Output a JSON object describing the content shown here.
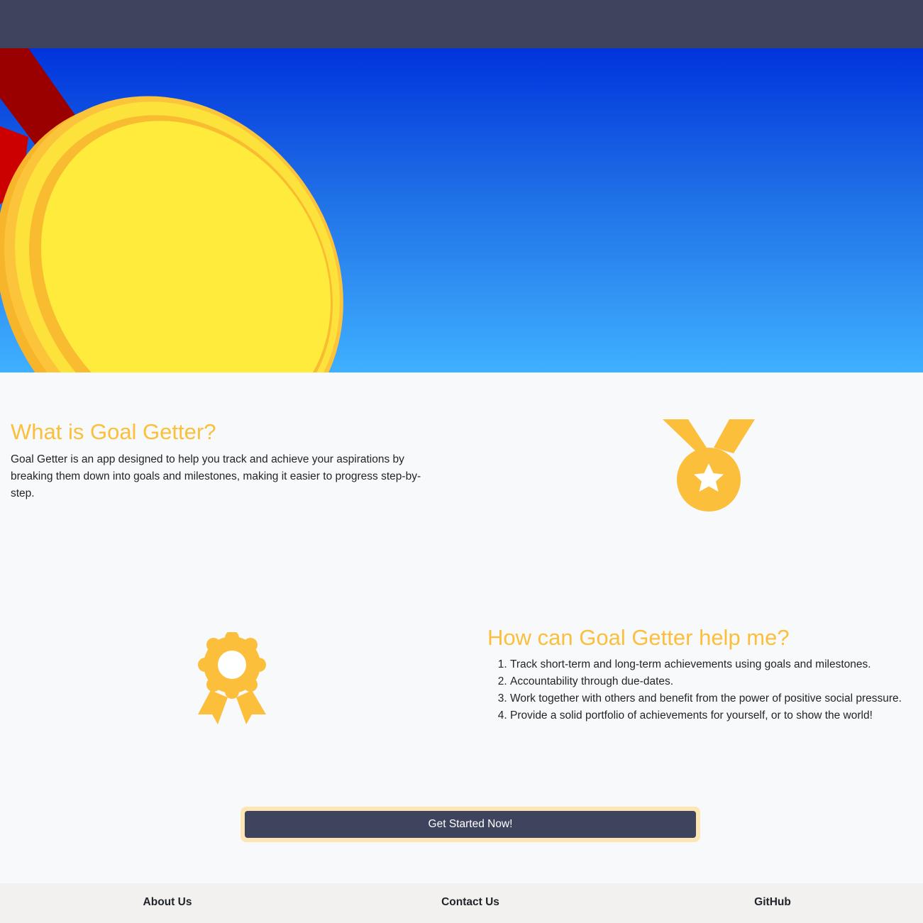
{
  "navbar": {},
  "hero": {
    "icon": "gold-medal-illustration"
  },
  "about": {
    "title": "What is Goal Getter?",
    "text": "Goal Getter is an app designed to help you track and achieve your aspirations by breaking them down into goals and milestones, making it easier to progress step-by-step.",
    "icon": "medal-star-icon"
  },
  "help": {
    "title": "How can Goal Getter help me?",
    "items": [
      "Track short-term and long-term achievements using goals and milestones.",
      "Accountability through due-dates.",
      "Work together with others and benefit from the power of positive social pressure.",
      "Provide a solid portfolio of achievements for yourself, or to show the world!"
    ],
    "icon": "award-rosette-icon"
  },
  "cta": {
    "label": "Get Started Now!"
  },
  "footer": {
    "links": [
      "About Us",
      "Contact Us",
      "GitHub"
    ]
  },
  "colors": {
    "navbar": "#3e445e",
    "accent": "#fcbf3c",
    "button": "#3e445e",
    "footer": "#f2f1f0"
  }
}
